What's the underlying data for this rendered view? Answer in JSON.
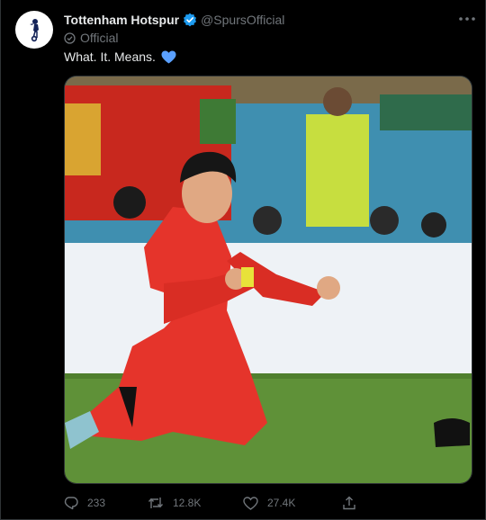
{
  "account": {
    "name": "Tottenham Hotspur",
    "handle": "@SpursOfficial",
    "label": "Official"
  },
  "tweet": {
    "text": "What. It. Means."
  },
  "stats": {
    "replies": "233",
    "retweets": "12.8K",
    "likes": "27.4K"
  },
  "colors": {
    "background": "#000000",
    "verified": "#1d9bf0",
    "heart": "#5aa0ff",
    "text_secondary": "#71767b",
    "jersey": "#e5342b"
  },
  "icons": {
    "avatar": "spurs-crest-icon",
    "verified": "verified-badge-icon",
    "more": "more-icon",
    "label": "official-label-icon",
    "emoji": "blue-heart-icon",
    "reply": "reply-icon",
    "retweet": "retweet-icon",
    "like": "like-icon",
    "share": "share-icon"
  }
}
